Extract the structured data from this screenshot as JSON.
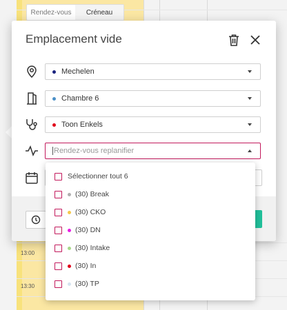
{
  "view_tabs": {
    "appointments": "Rendez-vous",
    "slot": "Créneau"
  },
  "times": {
    "t1300": "13:00",
    "t1330": "13:30"
  },
  "dialog": {
    "title": "Emplacement vide",
    "location": {
      "value": "Mechelen",
      "dot_color": "#1a237e"
    },
    "room": {
      "value": "Chambre 6",
      "dot_color": "#4a8fc7"
    },
    "practitioner": {
      "value": "Toon Enkels",
      "dot_color": "#e0001a"
    },
    "appointment_type": {
      "placeholder": "Rendez-vous replanifier"
    }
  },
  "dropdown": {
    "select_all": "Sélectionner tout 6",
    "options": [
      {
        "label": "(30) Break",
        "color": "#b0b0b0"
      },
      {
        "label": "(30) CKO",
        "color": "#f5c84c"
      },
      {
        "label": "(30) DN",
        "color": "#e81ee3"
      },
      {
        "label": "(30) Intake",
        "color": "#a8d98a"
      },
      {
        "label": "(30) In",
        "color": "#e0001a"
      },
      {
        "label": "(30) TP",
        "color": "#d5e4f0"
      }
    ]
  },
  "colors": {
    "accent": "#c2185b",
    "confirm": "#21c19b"
  }
}
